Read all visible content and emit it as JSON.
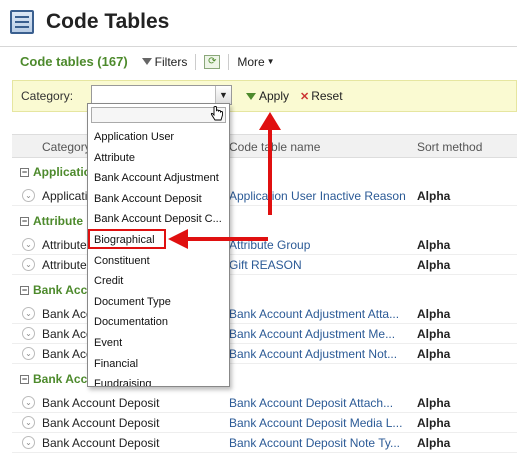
{
  "header": {
    "title": "Code Tables",
    "icon": "table-icon"
  },
  "toolbar": {
    "section_title": "Code tables (167)",
    "filters_label": "Filters",
    "more_label": "More"
  },
  "filter": {
    "category_label": "Category:",
    "category_value": "",
    "apply_label": "Apply",
    "reset_label": "Reset"
  },
  "columns": {
    "category": "Category",
    "code_table_name": "Code table name",
    "sort_method": "Sort method"
  },
  "groups": [
    {
      "label": "Application User"
    },
    {
      "label": "Attribute"
    },
    {
      "label": "Bank Account Adjustment"
    },
    {
      "label": "Bank Account Deposit"
    }
  ],
  "rows": [
    {
      "category": "Application User",
      "name": "Application User Inactive Reason",
      "sort": "Alpha"
    },
    {
      "category": "Attribute",
      "name": "Attribute Group",
      "sort": "Alpha"
    },
    {
      "category": "Attribute",
      "name": "Gift REASON",
      "sort": "Alpha"
    },
    {
      "category": "Bank Account Adjustment",
      "name": "Bank Account Adjustment Atta...",
      "sort": "Alpha"
    },
    {
      "category": "Bank Account Adjustment",
      "name": "Bank Account Adjustment Me...",
      "sort": "Alpha"
    },
    {
      "category": "Bank Account Adjustment",
      "name": "Bank Account Adjustment Not...",
      "sort": "Alpha"
    },
    {
      "category": "Bank Account Deposit",
      "name": "Bank Account Deposit Attach...",
      "sort": "Alpha"
    },
    {
      "category": "Bank Account Deposit",
      "name": "Bank Account Deposit Media L...",
      "sort": "Alpha"
    },
    {
      "category": "Bank Account Deposit",
      "name": "Bank Account Deposit Note Ty...",
      "sort": "Alpha"
    }
  ],
  "dropdown": {
    "items": [
      "Application User",
      "Attribute",
      "Bank Account Adjustment",
      "Bank Account Deposit",
      "Bank Account Deposit C...",
      "Biographical",
      "Constituent",
      "Credit",
      "Document Type",
      "Documentation",
      "Event",
      "Financial",
      "Fundraising"
    ],
    "selected_highlight": "Biographical"
  },
  "colors": {
    "accent": "#4d8a2c",
    "link": "#2b5a96",
    "annotation": "#e01010",
    "filter_bg": "#fafad2"
  }
}
